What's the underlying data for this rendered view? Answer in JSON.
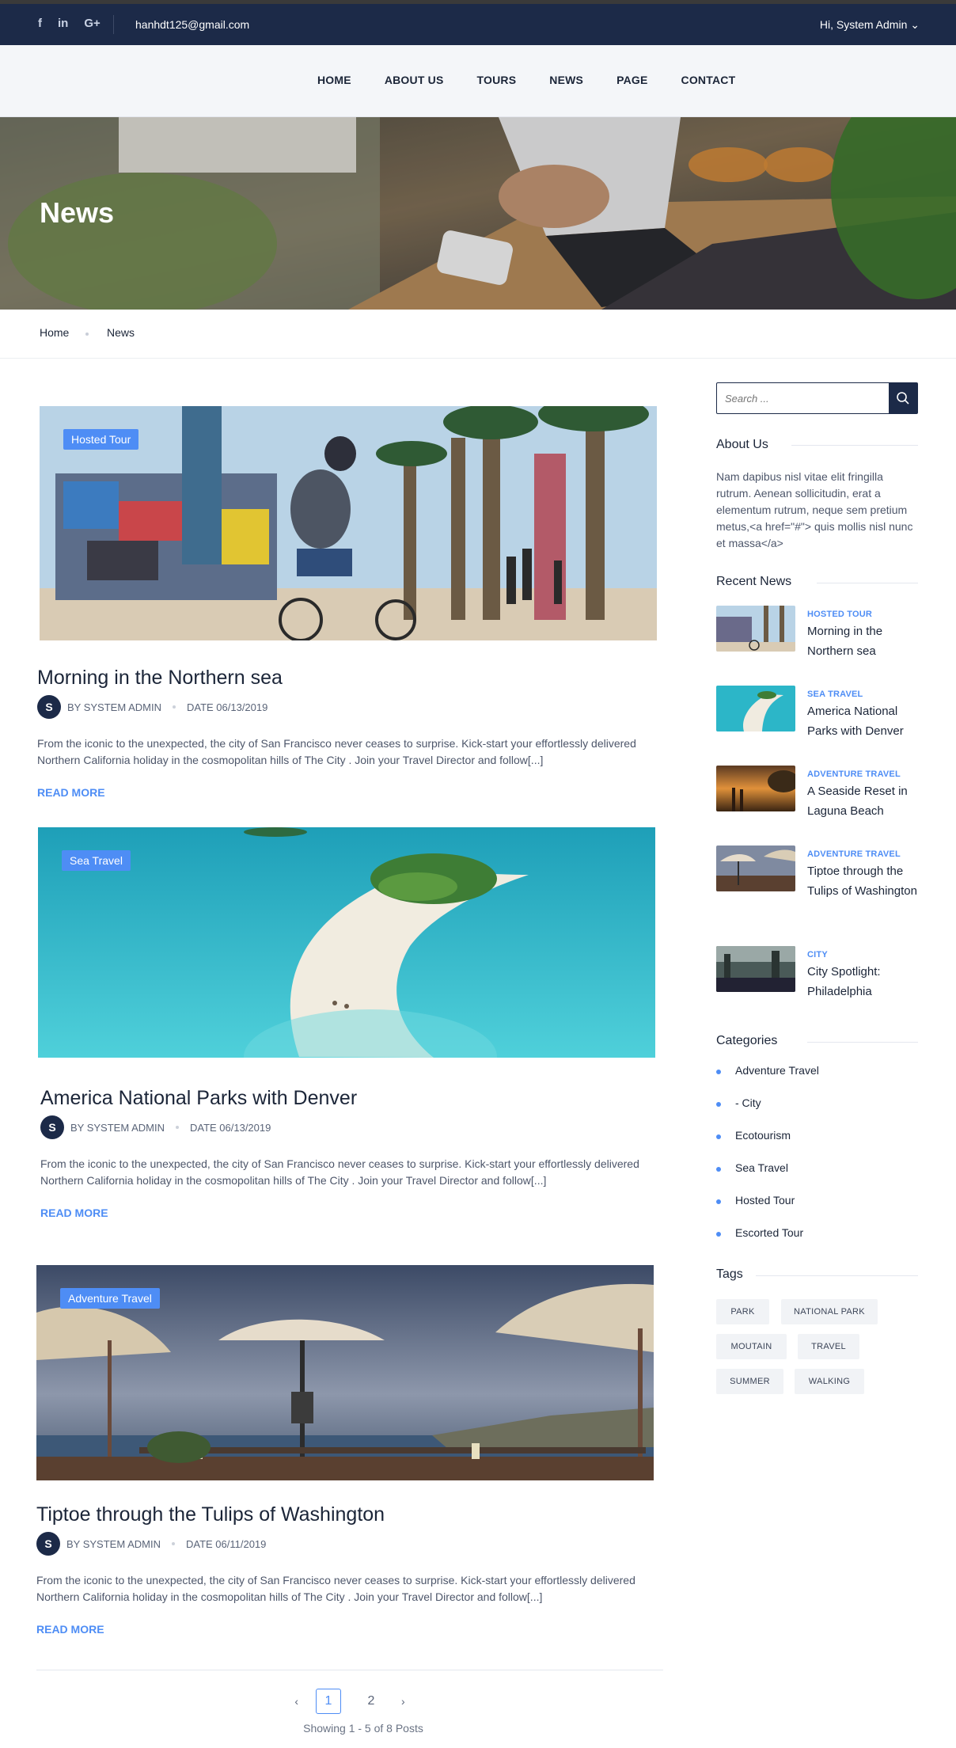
{
  "topbar": {
    "social": [
      {
        "icon": "facebook-icon",
        "glyph": "f"
      },
      {
        "icon": "linkedin-icon",
        "glyph": "in"
      },
      {
        "icon": "google-plus-icon",
        "glyph": "G+"
      }
    ],
    "email": "hanhdt125@gmail.com",
    "user": "Hi, System Admin ⌄"
  },
  "nav": {
    "items": [
      "HOME",
      "ABOUT US",
      "TOURS",
      "NEWS",
      "PAGE",
      "CONTACT"
    ]
  },
  "hero": {
    "title": "News"
  },
  "breadcrumb": {
    "home": "Home",
    "current": "News"
  },
  "posts": [
    {
      "badge": "Hosted Tour",
      "title": "Morning in the Northern sea",
      "avatar": "S",
      "author": "BY SYSTEM ADMIN",
      "date": "DATE 06/13/2019",
      "excerpt": "From the iconic to the unexpected, the city of San Francisco never ceases to surprise. Kick-start your effortlessly delivered Northern California holiday in the cosmopolitan hills of The City . Join your Travel Director and follow[...]",
      "read_more": "READ MORE"
    },
    {
      "badge": "Sea Travel",
      "title": "America National Parks with Denver",
      "avatar": "S",
      "author": "BY SYSTEM ADMIN",
      "date": "DATE 06/13/2019",
      "excerpt": "From the iconic to the unexpected, the city of San Francisco never ceases to surprise. Kick-start your effortlessly delivered Northern California holiday in the cosmopolitan hills of The City . Join your Travel Director and follow[...]",
      "read_more": "READ MORE"
    },
    {
      "badge": "Adventure Travel",
      "title": "Tiptoe through the Tulips of Washington",
      "avatar": "S",
      "author": "BY SYSTEM ADMIN",
      "date": "DATE 06/11/2019",
      "excerpt": "From the iconic to the unexpected, the city of San Francisco never ceases to surprise. Kick-start your effortlessly delivered Northern California holiday in the cosmopolitan hills of The City . Join your Travel Director and follow[...]",
      "read_more": "READ MORE"
    }
  ],
  "pagination": {
    "prev": "‹",
    "pages": [
      "1",
      "2"
    ],
    "active_page": "1",
    "next": "›",
    "showing": "Showing 1 - 5 of 8 Posts"
  },
  "sidebar": {
    "search_placeholder": "Search ...",
    "about": {
      "heading": "About Us",
      "text": "Nam dapibus nisl vitae elit fringilla rutrum. Aenean sollicitudin, erat a elementum rutrum, neque sem pretium metus,<a href=\"#\"> quis mollis nisl nunc et massa</a>"
    },
    "recent": {
      "heading": "Recent News",
      "items": [
        {
          "category": "HOSTED TOUR",
          "title": "Morning in the Northern sea"
        },
        {
          "category": "SEA TRAVEL",
          "title": "America National Parks with Denver"
        },
        {
          "category": "ADVENTURE TRAVEL",
          "title": "A Seaside Reset in Laguna Beach"
        },
        {
          "category": "ADVENTURE TRAVEL",
          "title": "Tiptoe through the Tulips of Washington"
        },
        {
          "category": "CITY",
          "title": "City Spotlight: Philadelphia"
        }
      ]
    },
    "categories": {
      "heading": "Categories",
      "items": [
        "Adventure Travel",
        "- City",
        "Ecotourism",
        "Sea Travel",
        "Hosted Tour",
        "Escorted Tour"
      ]
    },
    "tags": {
      "heading": "Tags",
      "items": [
        "PARK",
        "NATIONAL PARK",
        "MOUTAIN",
        "TRAVEL",
        "SUMMER",
        "WALKING"
      ]
    }
  },
  "colors": {
    "navy": "#1c2a48",
    "accent": "#4e8df5",
    "text": "#1b2538"
  }
}
